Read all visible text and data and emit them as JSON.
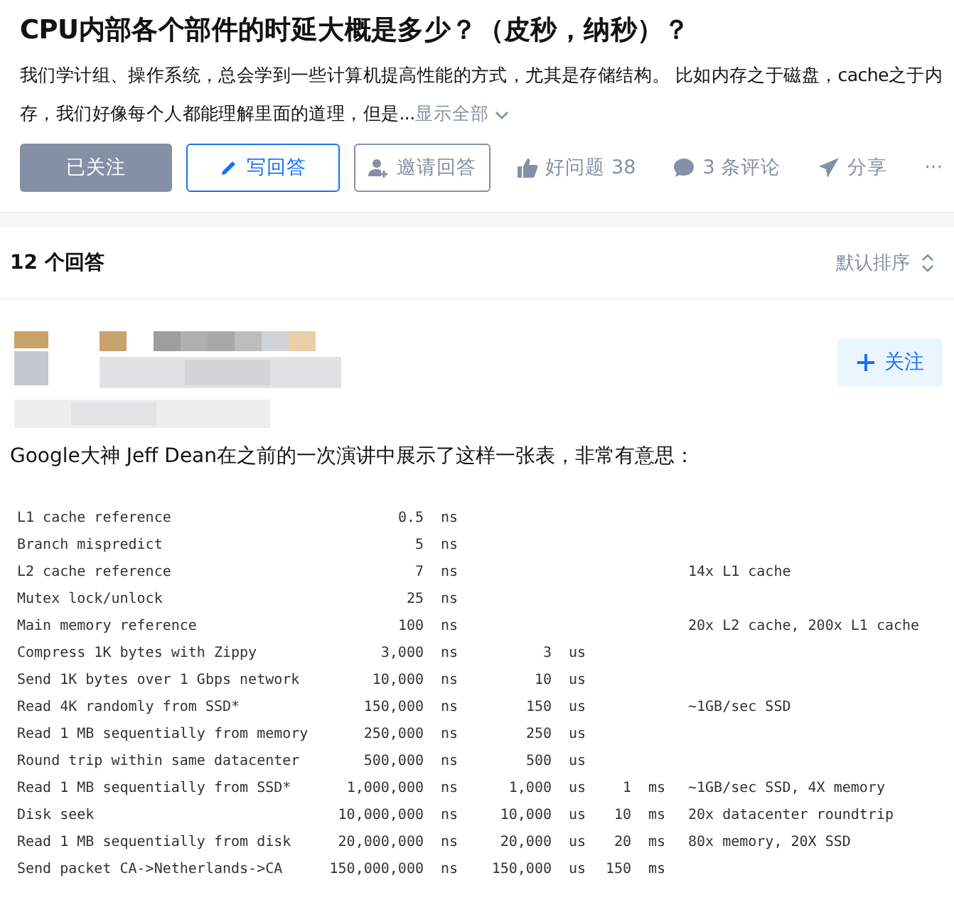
{
  "question": {
    "title": "CPU内部各个部件的时延大概是多少？（皮秒，纳秒）？",
    "excerpt": "我们学计组、操作系统，总会学到一些计算机提高性能的方式，尤其是存储结构。 比如内存之于磁盘，cache之于内存，我们好像每个人都能理解里面的道理，但是...",
    "show_all": "显示全部"
  },
  "actions": [
    {
      "kind": "followed",
      "label": "已关注"
    },
    {
      "kind": "write",
      "label": "写回答"
    },
    {
      "kind": "invite",
      "label": "邀请回答"
    },
    {
      "kind": "like",
      "label": "好问题 38"
    },
    {
      "kind": "comment",
      "label": "3 条评论"
    },
    {
      "kind": "share",
      "label": "分享"
    },
    {
      "kind": "more",
      "label": "···"
    }
  ],
  "answers": {
    "count": "12 个回答",
    "sort": "默认排序"
  },
  "answer": {
    "follow": "关注",
    "intro": "Google大神 Jeff Dean在之前的一次演讲中展示了这样一张表，非常有意思：",
    "table": [
      {
        "name": "L1 cache reference",
        "ns": "0.5",
        "ns_unit": "ns"
      },
      {
        "name": "Branch mispredict",
        "ns": "5",
        "ns_unit": "ns"
      },
      {
        "name": "L2 cache reference",
        "ns": "7",
        "ns_unit": "ns",
        "note": "14x L1 cache"
      },
      {
        "name": "Mutex lock/unlock",
        "ns": "25",
        "ns_unit": "ns"
      },
      {
        "name": "Main memory reference",
        "ns": "100",
        "ns_unit": "ns",
        "note": "20x L2 cache, 200x L1 cache"
      },
      {
        "name": "Compress 1K bytes with Zippy",
        "ns": "3,000",
        "ns_unit": "ns",
        "us": "3",
        "us_unit": "us"
      },
      {
        "name": "Send 1K bytes over 1 Gbps network",
        "ns": "10,000",
        "ns_unit": "ns",
        "us": "10",
        "us_unit": "us"
      },
      {
        "name": "Read 4K randomly from SSD*",
        "ns": "150,000",
        "ns_unit": "ns",
        "us": "150",
        "us_unit": "us",
        "note": "~1GB/sec SSD"
      },
      {
        "name": "Read 1 MB sequentially from memory",
        "ns": "250,000",
        "ns_unit": "ns",
        "us": "250",
        "us_unit": "us"
      },
      {
        "name": "Round trip within same datacenter",
        "ns": "500,000",
        "ns_unit": "ns",
        "us": "500",
        "us_unit": "us"
      },
      {
        "name": "Read 1 MB sequentially from SSD*",
        "ns": "1,000,000",
        "ns_unit": "ns",
        "us": "1,000",
        "us_unit": "us",
        "ms": "1",
        "ms_unit": "ms",
        "note": "~1GB/sec SSD, 4X memory"
      },
      {
        "name": "Disk seek",
        "ns": "10,000,000",
        "ns_unit": "ns",
        "us": "10,000",
        "us_unit": "us",
        "ms": "10",
        "ms_unit": "ms",
        "note": "20x datacenter roundtrip"
      },
      {
        "name": "Read 1 MB sequentially from disk",
        "ns": "20,000,000",
        "ns_unit": "ns",
        "us": "20,000",
        "us_unit": "us",
        "ms": "20",
        "ms_unit": "ms",
        "note": "80x memory, 20X SSD"
      },
      {
        "name": "Send packet CA->Netherlands->CA",
        "ns": "150,000,000",
        "ns_unit": "ns",
        "us": "150,000",
        "us_unit": "us",
        "ms": "150",
        "ms_unit": "ms"
      }
    ]
  }
}
